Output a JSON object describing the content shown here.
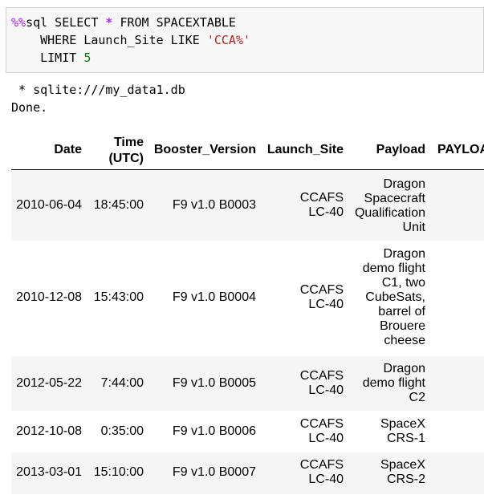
{
  "code_cell": {
    "line1_magic": "%%",
    "line1_rest": "sql SELECT ",
    "line1_star": "*",
    "line1_tail": " FROM SPACEXTABLE",
    "line2_pre": "    WHERE Launch_Site LIKE ",
    "line2_str": "'CCA%'",
    "line3_pre": "    LIMIT ",
    "line3_num": "5"
  },
  "output": {
    "connection": " * sqlite:///my_data1.db",
    "status": "Done."
  },
  "table": {
    "headers": {
      "date": "Date",
      "time_line1": "Time",
      "time_line2": "(UTC)",
      "booster": "Booster_Version",
      "site": "Launch_Site",
      "payload": "Payload",
      "payload_mass": "PAYLOAD_MASS__KG_"
    },
    "rows": [
      {
        "date": "2010-06-04",
        "time": "18:45:00",
        "booster": "F9 v1.0 B0003",
        "site": [
          "CCAFS",
          "LC-40"
        ],
        "payload": [
          "Dragon",
          "Spacecraft",
          "Qualification",
          "Unit"
        ]
      },
      {
        "date": "2010-12-08",
        "time": "15:43:00",
        "booster": "F9 v1.0 B0004",
        "site": [
          "CCAFS",
          "LC-40"
        ],
        "payload": [
          "Dragon",
          "demo flight",
          "C1, two",
          "CubeSats,",
          "barrel of",
          "Brouere",
          "cheese"
        ]
      },
      {
        "date": "2012-05-22",
        "time": "7:44:00",
        "booster": "F9 v1.0 B0005",
        "site": [
          "CCAFS",
          "LC-40"
        ],
        "payload": [
          "Dragon",
          "demo flight",
          "C2"
        ]
      },
      {
        "date": "2012-10-08",
        "time": "0:35:00",
        "booster": "F9 v1.0 B0006",
        "site": [
          "CCAFS",
          "LC-40"
        ],
        "payload": [
          "SpaceX",
          "CRS-1"
        ]
      },
      {
        "date": "2013-03-01",
        "time": "15:10:00",
        "booster": "F9 v1.0 B0007",
        "site": [
          "CCAFS",
          "LC-40"
        ],
        "payload": [
          "SpaceX",
          "CRS-2"
        ]
      }
    ]
  }
}
